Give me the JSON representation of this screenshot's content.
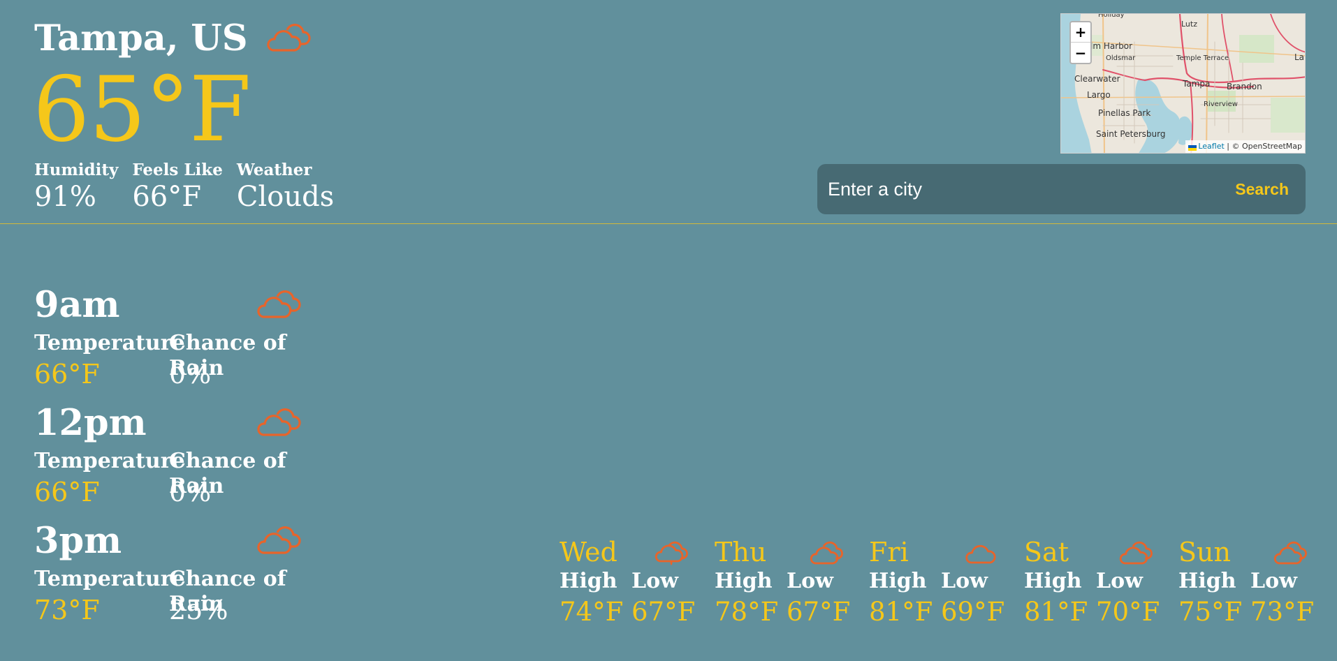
{
  "current": {
    "city": "Tampa, US",
    "icon": "cloud-icon",
    "temperature": "65°F",
    "stats": [
      {
        "label": "Humidity",
        "value": "91%"
      },
      {
        "label": "Feels Like",
        "value": "66°F"
      },
      {
        "label": "Weather",
        "value": "Clouds"
      }
    ]
  },
  "map": {
    "zoom_in_label": "+",
    "zoom_out_label": "−",
    "attribution_link": "Leaflet",
    "attribution_rest": "| © OpenStreetMap",
    "places": [
      "Holiday",
      "Lutz",
      "lm Harbor",
      "Oldsmar",
      "Temple Terrace",
      "Clearwater",
      "Tampa",
      "Brandon",
      "Largo",
      "Riverview",
      "Pinellas Park",
      "Saint Petersburg",
      "Lal"
    ]
  },
  "search": {
    "placeholder": "Enter a city",
    "button_label": "Search"
  },
  "hourly": {
    "temperature_label": "Temperature",
    "rain_label": "Chance of Rain",
    "items": [
      {
        "time": "9am",
        "icon": "cloud-icon",
        "temperature": "66°F",
        "rain": "0%"
      },
      {
        "time": "12pm",
        "icon": "cloud-icon",
        "temperature": "66°F",
        "rain": "0%"
      },
      {
        "time": "3pm",
        "icon": "cloud-icon",
        "temperature": "73°F",
        "rain": "25%"
      }
    ]
  },
  "daily": {
    "high_label": "High",
    "low_label": "Low",
    "items": [
      {
        "day": "Wed",
        "icon": "cloud-rain-icon",
        "high": "74°F",
        "low": "67°F"
      },
      {
        "day": "Thu",
        "icon": "cloud-icon",
        "high": "78°F",
        "low": "67°F"
      },
      {
        "day": "Fri",
        "icon": "cloud-single-icon",
        "high": "81°F",
        "low": "69°F"
      },
      {
        "day": "Sat",
        "icon": "cloud-icon",
        "high": "81°F",
        "low": "70°F"
      },
      {
        "day": "Sun",
        "icon": "cloud-icon",
        "high": "75°F",
        "low": "73°F"
      }
    ]
  },
  "colors": {
    "background": "#61909c",
    "accent": "#f5c71a",
    "icon": "#e8642a",
    "search_bg": "#476a73"
  }
}
